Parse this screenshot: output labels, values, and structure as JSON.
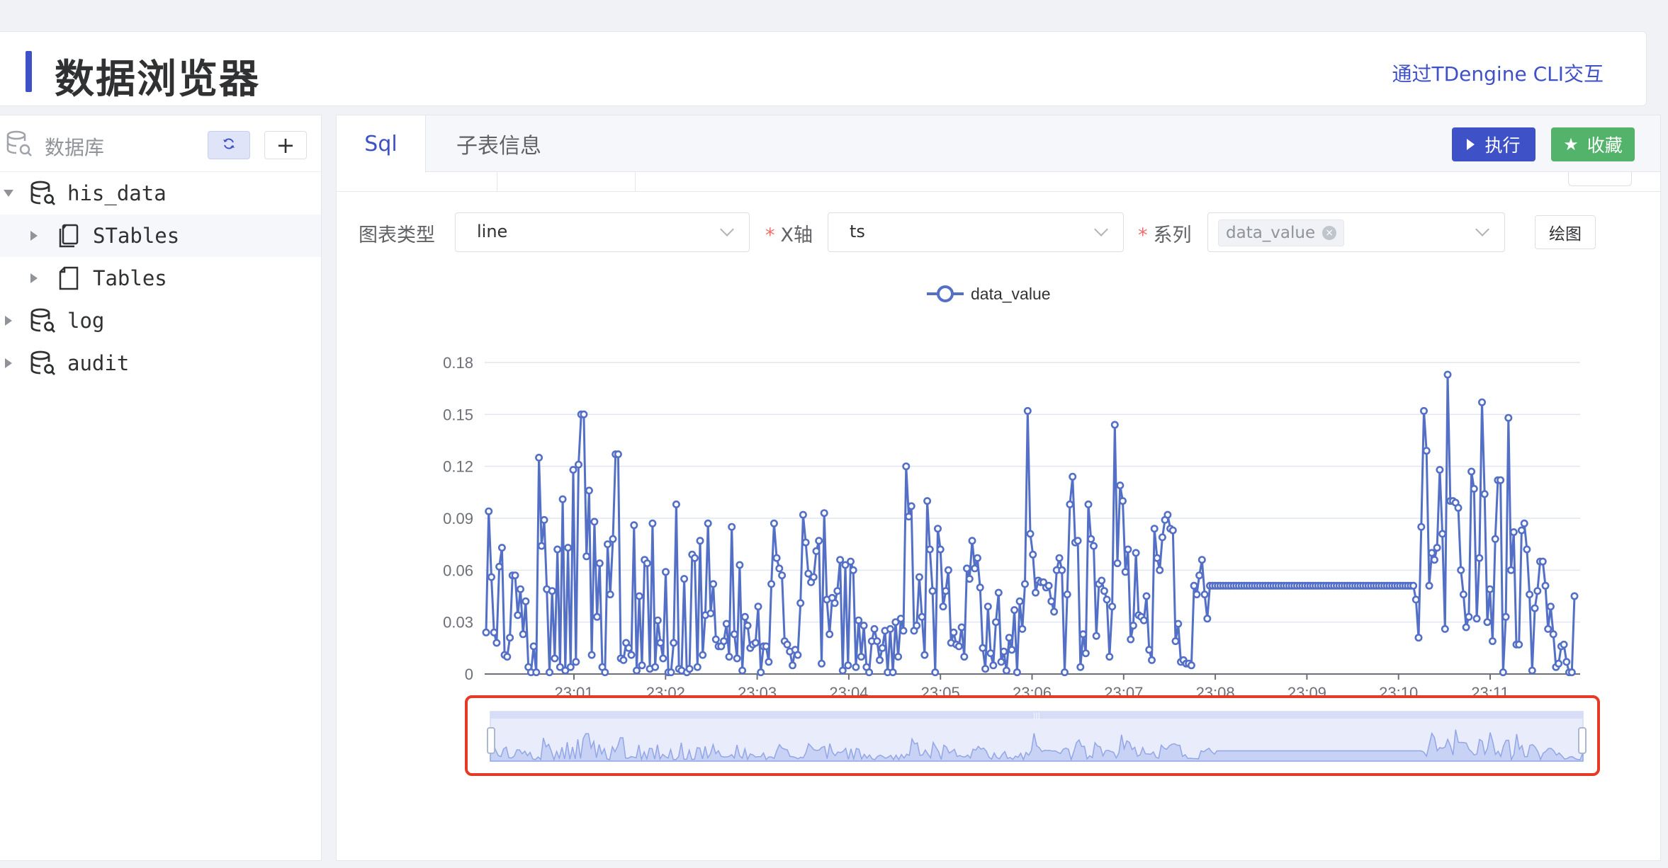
{
  "header": {
    "title": "数据浏览器",
    "cli_link": "通过TDengine CLI交互"
  },
  "sidebar": {
    "label": "数据库",
    "add_label": "+",
    "tree": [
      {
        "label": "his_data",
        "expanded": true
      },
      {
        "label": "STables"
      },
      {
        "label": "Tables"
      },
      {
        "label": "log"
      },
      {
        "label": "audit"
      }
    ]
  },
  "tabs": [
    {
      "label": "Sql"
    },
    {
      "label": "子表信息"
    }
  ],
  "toolbar": {
    "run_label": "执行",
    "fav_label": "收藏"
  },
  "controls": {
    "chart_type_label": "图表类型",
    "chart_type_value": "line",
    "x_label": "X轴",
    "x_value": "ts",
    "series_label": "系列",
    "series_tag": "data_value",
    "draw_label": "绘图"
  },
  "colors": {
    "accent": "#3f51c7",
    "success": "#54b36a",
    "series": "#5470c6",
    "highlight": "#e53a25"
  },
  "chart_data": {
    "type": "line",
    "legend": [
      "data_value"
    ],
    "legend_position": "top-center",
    "x_ticks": [
      "23:01",
      "23:02",
      "23:03",
      "23:04",
      "23:05",
      "23:06",
      "23:07",
      "23:08",
      "23:09",
      "23:10",
      "23:11"
    ],
    "y_ticks": [
      "0",
      "0.03",
      "0.06",
      "0.09",
      "0.12",
      "0.15",
      "0.18"
    ],
    "ylim": [
      0,
      0.18
    ],
    "grid": true,
    "data_zoom": true,
    "series": [
      {
        "name": "data_value",
        "values": [
          0.024,
          0.094,
          0.056,
          0.024,
          0.018,
          0.062,
          0.073,
          0.011,
          0.01,
          0.021,
          0.057,
          0.057,
          0.034,
          0.049,
          0.023,
          0.042,
          0.004,
          0.001,
          0.016,
          0.001,
          0.125,
          0.074,
          0.089,
          0.049,
          0.001,
          0.048,
          0.009,
          0.072,
          0.004,
          0.101,
          0.002,
          0.073,
          0.004,
          0.118,
          0.007,
          0.121,
          0.15,
          0.15,
          0.068,
          0.106,
          0.011,
          0.088,
          0.033,
          0.064,
          0.004,
          0.001,
          0.075,
          0.046,
          0.078,
          0.127,
          0.127,
          0.009,
          0.008,
          0.018,
          0.015,
          0.011,
          0.086,
          0.002,
          0.045,
          0.005,
          0.066,
          0.064,
          0.003,
          0.087,
          0.004,
          0.031,
          0.018,
          0.009,
          0.059,
          0.001,
          0.001,
          0.018,
          0.098,
          0.003,
          0.002,
          0.055,
          0.001,
          0.003,
          0.069,
          0.067,
          0.004,
          0.077,
          0.011,
          0.034,
          0.087,
          0.035,
          0.052,
          0.02,
          0.016,
          0.016,
          0.019,
          0.029,
          0.01,
          0.085,
          0.023,
          0.009,
          0.063,
          0.002,
          0.033,
          0.028,
          0.015,
          0.017,
          0.018,
          0.039,
          0.001,
          0.016,
          0.016,
          0.007,
          0.052,
          0.087,
          0.067,
          0.061,
          0.057,
          0.019,
          0.017,
          0.013,
          0.005,
          0.014,
          0.011,
          0.041,
          0.092,
          0.076,
          0.058,
          0.053,
          0.056,
          0.071,
          0.077,
          0.006,
          0.093,
          0.043,
          0.023,
          0.044,
          0.041,
          0.048,
          0.066,
          0.002,
          0.063,
          0.005,
          0.065,
          0.06,
          0.004,
          0.031,
          0.01,
          0.028,
          0.004,
          0.001,
          0.019,
          0.026,
          0.019,
          0.008,
          0.015,
          0.025,
          0.001,
          0.026,
          0.001,
          0.03,
          0.01,
          0.032,
          0.025,
          0.12,
          0.091,
          0.097,
          0.025,
          0.028,
          0.056,
          0.033,
          0.011,
          0.1,
          0.072,
          0.048,
          0.001,
          0.084,
          0.072,
          0.039,
          0.048,
          0.06,
          0.018,
          0.024,
          0.017,
          0.016,
          0.027,
          0.01,
          0.061,
          0.055,
          0.077,
          0.061,
          0.067,
          0.05,
          0.015,
          0.003,
          0.039,
          0.012,
          0.005,
          0.03,
          0.047,
          0.007,
          0.013,
          0.002,
          0.021,
          0.014,
          0.037,
          0.001,
          0.042,
          0.026,
          0.052,
          0.152,
          0.081,
          0.069,
          0.047,
          0.054,
          0.053,
          0.053,
          0.05,
          0.051,
          0.042,
          0.036,
          0.06,
          0.067,
          0.06,
          0.001,
          0.046,
          0.098,
          0.114,
          0.076,
          0.077,
          0.004,
          0.023,
          0.012,
          0.098,
          0.078,
          0.074,
          0.022,
          0.052,
          0.054,
          0.048,
          0.043,
          0.01,
          0.039,
          0.144,
          0.064,
          0.109,
          0.1,
          0.059,
          0.072,
          0.02,
          0.028,
          0.07,
          0.034,
          0.033,
          0.031,
          0.045,
          0.014,
          0.008,
          0.084,
          0.067,
          0.06,
          0.079,
          0.089,
          0.092,
          0.084,
          0.083,
          0.019,
          0.029,
          0.007,
          0.008,
          0.006,
          0.006,
          0.005,
          0.051,
          0.046,
          0.057,
          0.066,
          0.046,
          0.032,
          0.051,
          0.051,
          0.051,
          0.051,
          0.051,
          0.051,
          0.051,
          0.051,
          0.051,
          0.051,
          0.051,
          0.051,
          0.051,
          0.051,
          0.051,
          0.051,
          0.051,
          0.051,
          0.051,
          0.051,
          0.051,
          0.051,
          0.051,
          0.051,
          0.051,
          0.051,
          0.051,
          0.051,
          0.051,
          0.051,
          0.051,
          0.051,
          0.051,
          0.051,
          0.051,
          0.051,
          0.051,
          0.051,
          0.051,
          0.051,
          0.051,
          0.051,
          0.051,
          0.051,
          0.051,
          0.051,
          0.051,
          0.051,
          0.051,
          0.051,
          0.051,
          0.051,
          0.051,
          0.051,
          0.051,
          0.051,
          0.051,
          0.051,
          0.051,
          0.051,
          0.051,
          0.051,
          0.051,
          0.051,
          0.051,
          0.051,
          0.051,
          0.051,
          0.051,
          0.051,
          0.051,
          0.051,
          0.051,
          0.051,
          0.051,
          0.051,
          0.051,
          0.051,
          0.043,
          0.021,
          0.085,
          0.152,
          0.129,
          0.051,
          0.07,
          0.066,
          0.073,
          0.118,
          0.081,
          0.026,
          0.173,
          0.1,
          0.1,
          0.099,
          0.096,
          0.06,
          0.046,
          0.027,
          0.033,
          0.117,
          0.107,
          0.032,
          0.067,
          0.157,
          0.104,
          0.03,
          0.049,
          0.019,
          0.078,
          0.112,
          0.112,
          0.001,
          0.033,
          0.148,
          0.06,
          0.082,
          0.017,
          0.017,
          0.083,
          0.087,
          0.072,
          0.046,
          0.002,
          0.038,
          0.048,
          0.065,
          0.065,
          0.051,
          0.026,
          0.039,
          0.023,
          0.004,
          0.006,
          0.016,
          0.017,
          0.007,
          0.001,
          0.001,
          0.045
        ]
      }
    ]
  }
}
